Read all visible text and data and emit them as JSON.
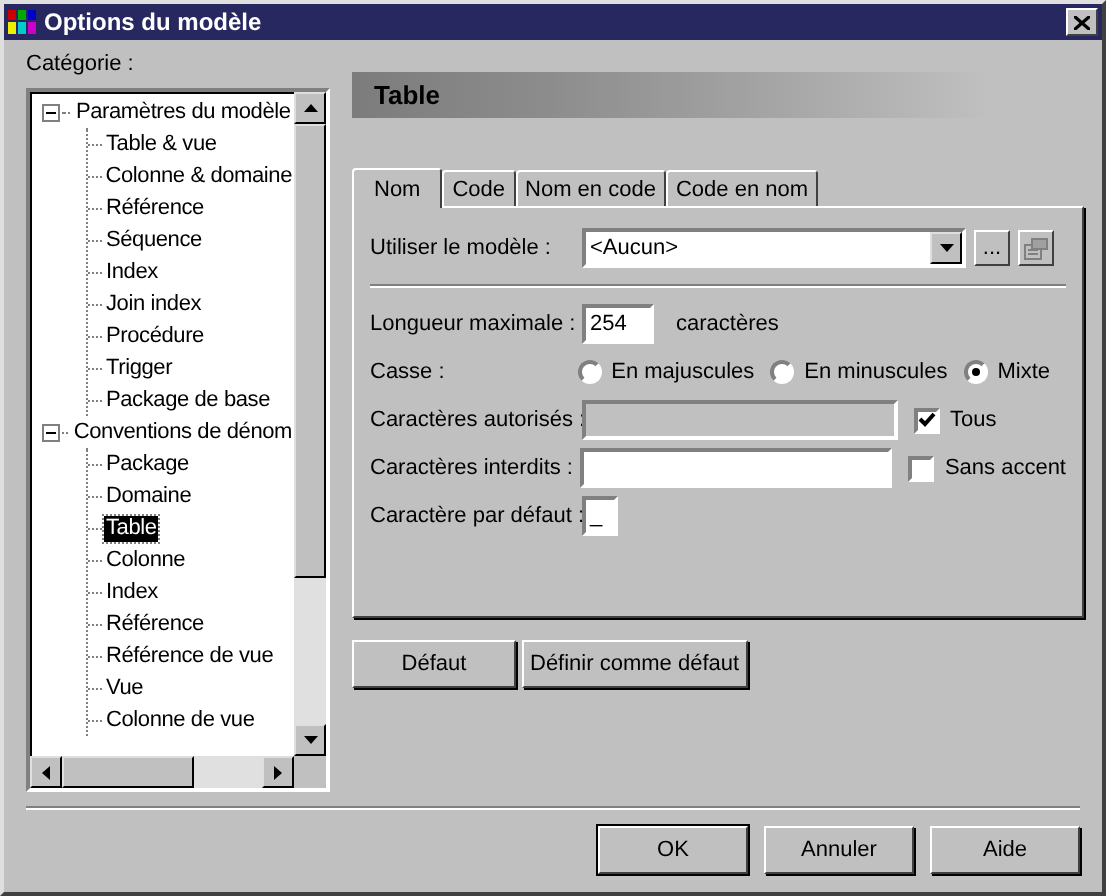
{
  "window": {
    "title": "Options du modèle"
  },
  "category_label": "Catégorie :",
  "tree": [
    {
      "label": "Paramètres du modèle",
      "expanded": true,
      "selected": false,
      "children": [
        {
          "label": "Table & vue",
          "selected": false
        },
        {
          "label": "Colonne & domaine",
          "selected": false
        },
        {
          "label": "Référence",
          "selected": false
        },
        {
          "label": "Séquence",
          "selected": false
        },
        {
          "label": "Index",
          "selected": false
        },
        {
          "label": "Join index",
          "selected": false
        },
        {
          "label": "Procédure",
          "selected": false
        },
        {
          "label": "Trigger",
          "selected": false
        },
        {
          "label": "Package de base",
          "selected": false
        }
      ]
    },
    {
      "label": "Conventions de dénom",
      "expanded": true,
      "selected": false,
      "children": [
        {
          "label": "Package",
          "selected": false
        },
        {
          "label": "Domaine",
          "selected": false
        },
        {
          "label": "Table",
          "selected": true
        },
        {
          "label": "Colonne",
          "selected": false
        },
        {
          "label": "Index",
          "selected": false
        },
        {
          "label": "Référence",
          "selected": false
        },
        {
          "label": "Référence de vue",
          "selected": false
        },
        {
          "label": "Vue",
          "selected": false
        },
        {
          "label": "Colonne de vue",
          "selected": false
        }
      ]
    }
  ],
  "header": {
    "title": "Table"
  },
  "tabs": [
    {
      "label": "Nom",
      "selected": true
    },
    {
      "label": "Code",
      "selected": false
    },
    {
      "label": "Nom en code",
      "selected": false
    },
    {
      "label": "Code en nom",
      "selected": false
    }
  ],
  "form": {
    "model": {
      "label": "Utiliser le modèle  :",
      "value": "<Aucun>",
      "browse_label": "..."
    },
    "max_length": {
      "label": "Longueur maximale :",
      "value": "254",
      "unit": "caractères"
    },
    "case": {
      "label": "Casse :",
      "options": [
        {
          "label": "En majuscules",
          "selected": false
        },
        {
          "label": "En minuscules",
          "selected": false
        },
        {
          "label": "Mixte",
          "selected": true
        }
      ]
    },
    "allowed": {
      "label": "Caractères autorisés :",
      "disabled": true,
      "checkbox": {
        "label": "Tous",
        "checked": true
      }
    },
    "forbidden": {
      "label": "Caractères interdits :",
      "disabled": false,
      "checkbox": {
        "label": "Sans accent",
        "checked": false
      }
    },
    "default_char": {
      "label": "Caractère par défaut :",
      "value": "_"
    }
  },
  "panel_buttons": [
    "Défaut",
    "Définir comme défaut"
  ],
  "footer_buttons": [
    {
      "label": "OK",
      "default": true
    },
    {
      "label": "Annuler",
      "default": false
    },
    {
      "label": "Aide",
      "default": false
    }
  ]
}
